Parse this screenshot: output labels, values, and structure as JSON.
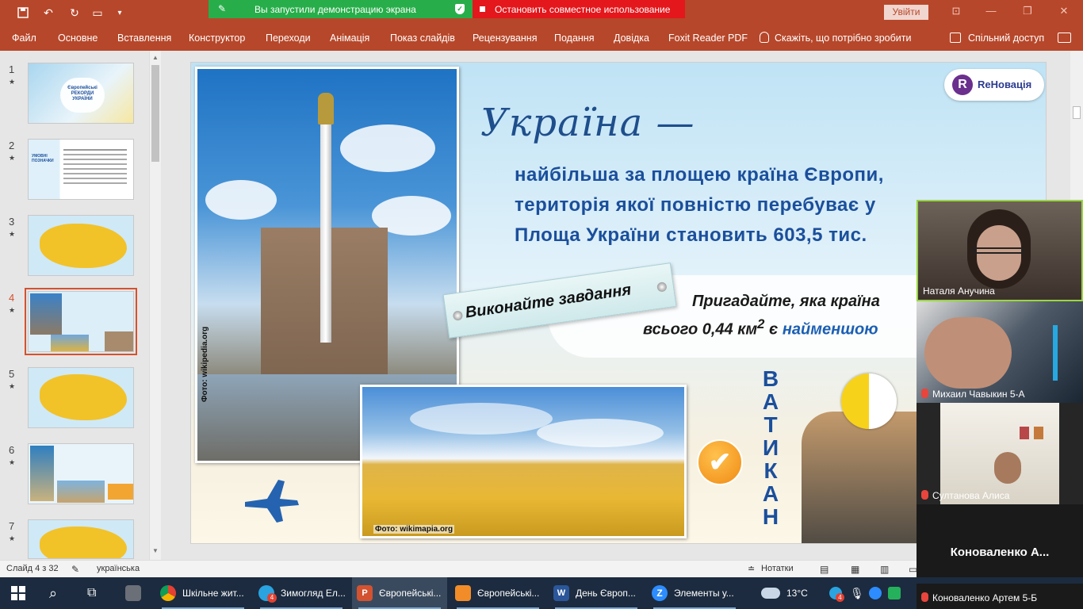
{
  "share_banner": {
    "on_text": "Вы запустили демонстрацию экрана",
    "stop_text": "Остановить совместное использование"
  },
  "titlebar": {
    "signin": "Увійти"
  },
  "ribbon": {
    "tabs": [
      "Файл",
      "Основне",
      "Вставлення",
      "Конструктор",
      "Переходи",
      "Анімація",
      "Показ слайдів",
      "Рецензування",
      "Подання",
      "Довідка",
      "Foxit Reader PDF"
    ],
    "tell_me": "Скажіть, що потрібно зробити",
    "share": "Спільний доступ"
  },
  "thumbnails": {
    "numbers": [
      "1",
      "2",
      "3",
      "4",
      "5",
      "6",
      "7"
    ],
    "star": "★",
    "selected": "4",
    "slide1_title": "Європейські РЕКОРДИ УКРАЇНИ",
    "slide2_label": "УМОВНІ ПОЗНАЧКИ"
  },
  "slide": {
    "logo_text": "ReНовація",
    "logo_letter": "R",
    "heading": "Україна —",
    "lines": [
      "найбільша за площею країна Європи,",
      "територія якої повністю перебуває у",
      "Площа України становить 603,5 тис."
    ],
    "task_label": "Виконайте завдання",
    "question_1": "Пригадайте, яка країна",
    "question_2a": "всього 0,44 км",
    "question_2sup": "2",
    "question_2b": " є ",
    "question_2hl": "найменшою",
    "answer_letters": [
      "В",
      "А",
      "Т",
      "И",
      "К",
      "А",
      "Н"
    ],
    "photo1_caption": "Фото: wikipedia.org",
    "photo2_caption": "Фото: wikimapia.org",
    "check_glyph": "✔"
  },
  "video_tiles": [
    {
      "name": "Наталя Анучина",
      "muted": false
    },
    {
      "name": "Михаил Чавыкин 5-А",
      "muted": true
    },
    {
      "name": "Султанова Алиса",
      "muted": true
    },
    {
      "name": "Коноваленко  А...",
      "muted": false,
      "avatar_only": true
    },
    {
      "name": "Коноваленко Артем 5-Б",
      "muted": true
    }
  ],
  "statusbar": {
    "slide_info": "Слайд 4 з 32",
    "language": "українська",
    "notes": "Нотатки"
  },
  "taskbar": {
    "items": [
      {
        "label": "Шкільне жит...",
        "color": "#e34133"
      },
      {
        "label": "Зимогляд Ел...",
        "color": "#2aa3e1",
        "badge": "4"
      },
      {
        "label": "Європейські...",
        "color": "#d35230",
        "active": true
      },
      {
        "label": "Європейські...",
        "color": "#f28c28"
      },
      {
        "label": "День Європ...",
        "color": "#2b579a"
      },
      {
        "label": "Элементы у...",
        "color": "#2d8cff"
      }
    ],
    "weather": "13°C",
    "tray_badge": "4"
  },
  "colors": {
    "ppt_accent": "#b7472a",
    "share_green": "#27ae4a",
    "share_red": "#e3171c",
    "slide_heading": "#1b4f9c"
  }
}
